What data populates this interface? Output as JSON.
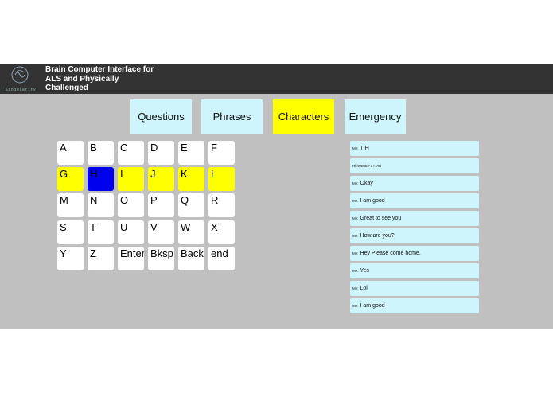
{
  "header": {
    "logo_text": "Singularity",
    "title_line1": "Brain Computer Interface for",
    "title_line2": "ALS and Physically",
    "title_line3": "Challenged"
  },
  "tabs": [
    {
      "label": "Questions",
      "active": false
    },
    {
      "label": "Phrases",
      "active": false
    },
    {
      "label": "Characters",
      "active": true
    },
    {
      "label": "Emergency",
      "active": false
    }
  ],
  "keyboard": {
    "rows": [
      [
        "A",
        "B",
        "C",
        "D",
        "E",
        "F"
      ],
      [
        "G",
        "H",
        "I",
        "J",
        "K",
        "L"
      ],
      [
        "M",
        "N",
        "O",
        "P",
        "Q",
        "R"
      ],
      [
        "S",
        "T",
        "U",
        "V",
        "W",
        "X"
      ],
      [
        "Y",
        "Z",
        "Enter",
        "Bksp",
        "Back",
        "end"
      ]
    ],
    "highlighted_row": 1,
    "selected_key": "H",
    "highlight_color": "#ffff00",
    "selected_color": "#0000ee"
  },
  "messages": [
    {
      "sender": "Me:",
      "text": "TIH"
    },
    {
      "sender": "",
      "text": "Hi how are u?..Ari"
    },
    {
      "sender": "Me:",
      "text": "Okay"
    },
    {
      "sender": "Me:",
      "text": "I am good"
    },
    {
      "sender": "Me:",
      "text": "Great to see you"
    },
    {
      "sender": "Me:",
      "text": "How are you?"
    },
    {
      "sender": "Me:",
      "text": "Hey Please come home."
    },
    {
      "sender": "Me:",
      "text": "Yes"
    },
    {
      "sender": "Me:",
      "text": "Lol"
    },
    {
      "sender": "Me:",
      "text": "I am good"
    }
  ]
}
